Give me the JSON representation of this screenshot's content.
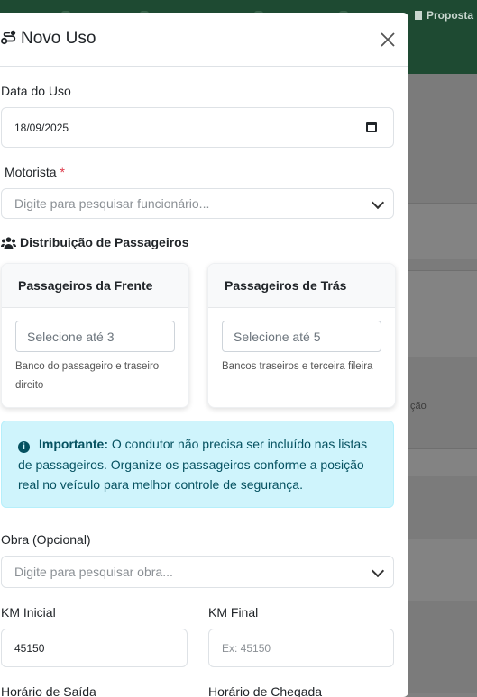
{
  "topbar": {
    "proposta_label": "Proposta"
  },
  "background": {
    "partial_text": "ção"
  },
  "modal": {
    "title": "Novo Uso",
    "title_icon": "route-icon",
    "close_icon": "close-icon"
  },
  "form": {
    "data_uso": {
      "label": "Data do Uso",
      "value": "18/09/2025",
      "icon": "calendar-icon"
    },
    "motorista": {
      "label": "Motorista",
      "required_mark": "*",
      "placeholder": "Digite para pesquisar funcionário..."
    },
    "distribuicao": {
      "title": "Distribuição de Passageiros",
      "icon": "users-icon"
    },
    "passageiros_frente": {
      "title": "Passageiros da Frente",
      "placeholder": "Selecione até 3",
      "help": "Banco do passageiro e traseiro direito"
    },
    "passageiros_tras": {
      "title": "Passageiros de Trás",
      "placeholder": "Selecione até 5",
      "help": "Bancos traseiros e terceira fileira"
    },
    "alert": {
      "icon": "info-icon",
      "strong": "Importante:",
      "text": " O condutor não precisa ser incluído nas listas de passageiros. Organize os passageiros conforme a posição real no veículo para melhor controle de segurança."
    },
    "obra": {
      "label": "Obra (Opcional)",
      "placeholder": "Digite para pesquisar obra..."
    },
    "km_inicial": {
      "label": "KM Inicial",
      "value": "45150"
    },
    "km_final": {
      "label": "KM Final",
      "placeholder": "Ex: 45150"
    },
    "horario_saida": {
      "label": "Horário de Saída"
    },
    "horario_chegada": {
      "label": "Horário de Chegada"
    }
  },
  "colors": {
    "header_green": "#1e4a32",
    "alert_bg": "#cff4fc",
    "alert_text": "#055160",
    "required": "#dc3545"
  }
}
